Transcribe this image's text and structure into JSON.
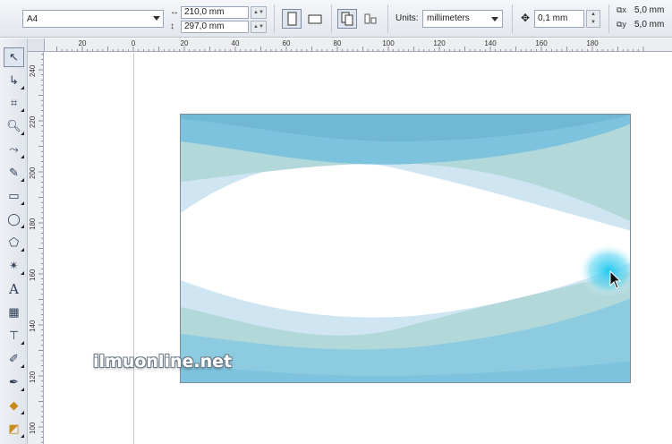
{
  "propbar": {
    "paper_size": "A4",
    "width_value": "210,0 mm",
    "height_value": "297,0 mm",
    "units_label": "Units:",
    "units_value": "millimeters",
    "nudge_value": "0,1 mm",
    "dup_x_value": "5,0 mm",
    "dup_y_value": "5,0 mm"
  },
  "hruler": {
    "labels": [
      "20",
      "0",
      "20",
      "40",
      "60",
      "80",
      "100",
      "120",
      "140",
      "160",
      "180"
    ]
  },
  "vruler": {
    "labels": [
      "240",
      "220",
      "200",
      "180",
      "160",
      "140",
      "120",
      "100"
    ]
  },
  "watermark": "ilmuonline.net",
  "colors": {
    "card_blue": "#7ec3dd",
    "card_light": "#cfe6f2",
    "card_mint": "#b3d8da",
    "glow": "#1fc8f0"
  },
  "toolbox": [
    "pick-tool",
    "shape-tool",
    "crop-tool",
    "zoom-tool",
    "freehand-tool",
    "smart-fill-tool",
    "rectangle-tool",
    "ellipse-tool",
    "polygon-tool",
    "basic-shapes-tool",
    "text-tool",
    "table-tool",
    "dimension-tool",
    "eyedropper-tool",
    "outline-tool",
    "fill-tool",
    "interactive-fill-tool"
  ]
}
